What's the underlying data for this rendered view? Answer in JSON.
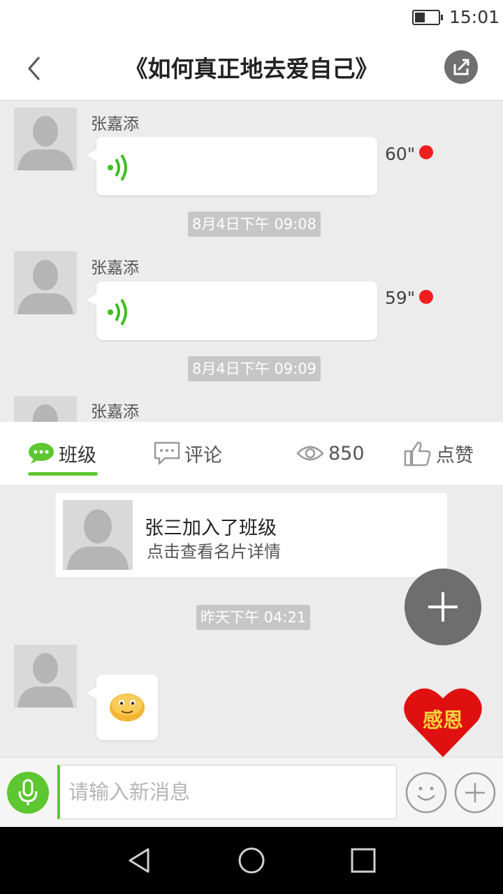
{
  "status_bar": {
    "time": "15:01",
    "battery_level": 0.45
  },
  "header": {
    "title": "《如何真正地去爱自己》"
  },
  "messages": [
    {
      "sender": "张嘉添",
      "duration": "60\"",
      "unread": true
    },
    {
      "timestamp": "8月4日下午 09:08"
    },
    {
      "sender": "张嘉添",
      "duration": "59\"",
      "unread": true
    },
    {
      "timestamp": "8月4日下午 09:09"
    },
    {
      "sender": "张嘉添"
    }
  ],
  "tabs": [
    {
      "label": "班级",
      "icon": "chat-bubble-icon",
      "active": true
    },
    {
      "label": "评论",
      "icon": "comment-icon",
      "active": false
    },
    {
      "label": "850",
      "icon": "eye-icon",
      "active": false
    },
    {
      "label": "点赞",
      "icon": "thumbs-up-icon",
      "active": false
    }
  ],
  "join_card": {
    "title": "张三加入了班级",
    "subtitle": "点击查看名片详情"
  },
  "timestamp_recent": "昨天下午 04:21",
  "emoji_message": {
    "icon": "smile-emoji-icon"
  },
  "floating": {
    "heart_label": "感恩"
  },
  "input": {
    "placeholder": "请输入新消息",
    "value": ""
  },
  "colors": {
    "accent": "#5cc730",
    "unread": "#f01f1f",
    "heart": "#e01010",
    "heart_text": "#f4d23b"
  }
}
